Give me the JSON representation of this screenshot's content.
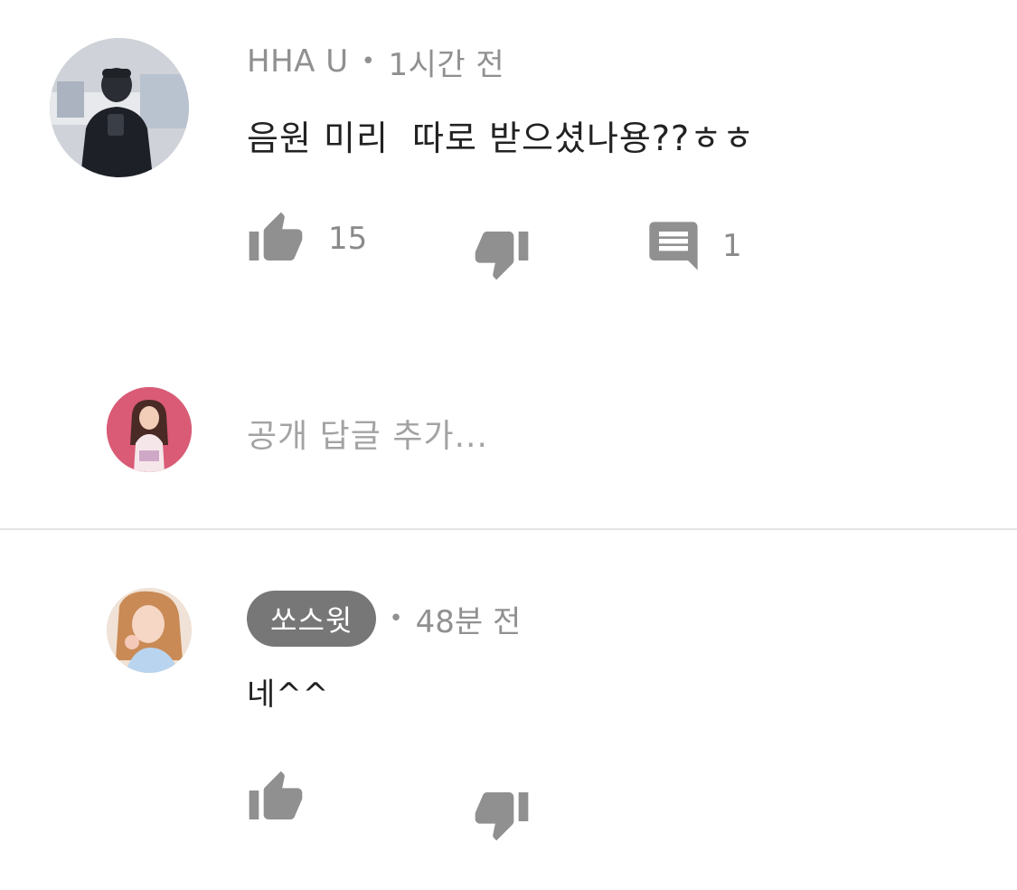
{
  "comments": [
    {
      "author": "HHA U",
      "separator": "•",
      "time": "1시간 전",
      "text": "음원 미리  따로 받으셨나용??ㅎㅎ",
      "likes": "15",
      "replies": "1"
    },
    {
      "author": "쏘스윗",
      "separator": "•",
      "time": "48분 전",
      "text": "네^^"
    }
  ],
  "reply_box": {
    "placeholder": "공개 답글 추가..."
  },
  "icons": {
    "like": "thumbs-up-icon",
    "dislike": "thumbs-down-icon",
    "reply": "comment-icon"
  },
  "colors": {
    "icon_gray": "#909090",
    "author_pill": "#777777",
    "divider": "#e4e4e4"
  }
}
